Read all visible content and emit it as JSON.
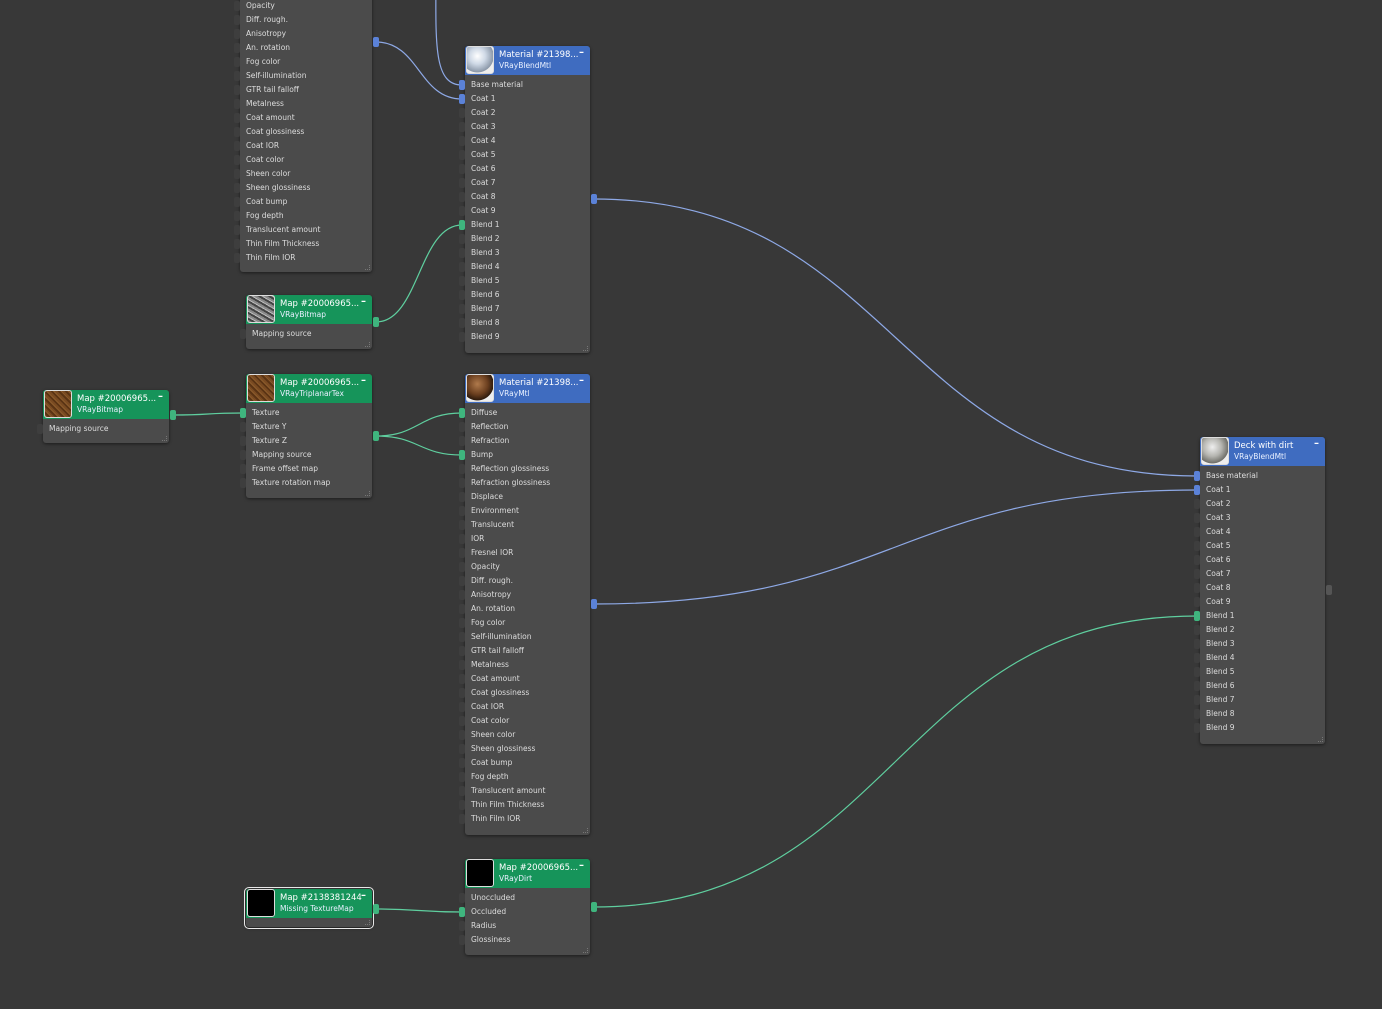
{
  "colors": {
    "material_header": "#3f6cc0",
    "map_header": "#16945a",
    "wire_material": "#8ea9e6",
    "wire_map": "#5fcf9f",
    "port_material": "#5b82d8",
    "port_map": "#3fb57e",
    "background": "#383838"
  },
  "nodes": [
    {
      "id": "vraymtl_top",
      "title": "",
      "type": "",
      "kind": "material",
      "thumb": "none",
      "rows": [
        "Opacity",
        "Diff. rough.",
        "Anisotropy",
        "An. rotation",
        "Fog color",
        "Self-illumination",
        "GTR tail falloff",
        "Metalness",
        "Coat amount",
        "Coat glossiness",
        "Coat IOR",
        "Coat color",
        "Sheen color",
        "Sheen glossiness",
        "Coat bump",
        "Fog depth",
        "Translucent amount",
        "Thin Film Thickness",
        "Thin Film IOR"
      ],
      "connected": []
    },
    {
      "id": "bitmap_top",
      "title": "Map #20006965...",
      "type": "VRayBitmap",
      "kind": "map",
      "thumb": "gray-texture",
      "rows": [
        "Mapping source"
      ],
      "connected": []
    },
    {
      "id": "blend_top",
      "title": "Material #21398...",
      "type": "VRayBlendMtl",
      "kind": "material",
      "thumb": "white-sphere",
      "rows": [
        "Base material",
        "Coat 1",
        "Coat 2",
        "Coat 3",
        "Coat 4",
        "Coat 5",
        "Coat 6",
        "Coat 7",
        "Coat 8",
        "Coat 9",
        "Blend 1",
        "Blend 2",
        "Blend 3",
        "Blend 4",
        "Blend 5",
        "Blend 6",
        "Blend 7",
        "Blend 8",
        "Blend 9"
      ],
      "connected": [
        "Base material",
        "Coat 1",
        "Blend 1"
      ]
    },
    {
      "id": "bitmap_left",
      "title": "Map #20006965...",
      "type": "VRayBitmap",
      "kind": "map",
      "thumb": "brown-texture",
      "rows": [
        "Mapping source"
      ],
      "connected": []
    },
    {
      "id": "triplanar",
      "title": "Map #20006965...",
      "type": "VRayTriplanarTex",
      "kind": "map",
      "thumb": "brown-texture",
      "rows": [
        "Texture",
        "Texture Y",
        "Texture Z",
        "Mapping source",
        "Frame offset map",
        "Texture rotation map"
      ],
      "connected": [
        "Texture"
      ]
    },
    {
      "id": "vraymtl_mid",
      "title": "Material #21398...",
      "type": "VRayMtl",
      "kind": "material",
      "thumb": "brown-sphere",
      "rows": [
        "Diffuse",
        "Reflection",
        "Refraction",
        "Bump",
        "Reflection glossiness",
        "Refraction glossiness",
        "Displace",
        "Environment",
        "Translucent",
        "IOR",
        "Fresnel IOR",
        "Opacity",
        "Diff. rough.",
        "Anisotropy",
        "An. rotation",
        "Fog color",
        "Self-illumination",
        "GTR tail falloff",
        "Metalness",
        "Coat amount",
        "Coat glossiness",
        "Coat IOR",
        "Coat color",
        "Sheen color",
        "Sheen glossiness",
        "Coat bump",
        "Fog depth",
        "Translucent amount",
        "Thin Film Thickness",
        "Thin Film IOR"
      ],
      "connected": [
        "Diffuse",
        "Bump"
      ]
    },
    {
      "id": "missing",
      "title": "Map #2138381244",
      "type": "Missing TextureMap",
      "kind": "map",
      "thumb": "black",
      "rows": [],
      "connected": [],
      "selected": true
    },
    {
      "id": "dirt",
      "title": "Map #20006965...",
      "type": "VRayDirt",
      "kind": "map",
      "thumb": "black",
      "rows": [
        "Unoccluded",
        "Occluded",
        "Radius",
        "Glossiness"
      ],
      "connected": [
        "Occluded"
      ]
    },
    {
      "id": "deck",
      "title": "Deck with dirt",
      "type": "VRayBlendMtl",
      "kind": "material",
      "thumb": "gray-sphere",
      "rows": [
        "Base material",
        "Coat 1",
        "Coat 2",
        "Coat 3",
        "Coat 4",
        "Coat 5",
        "Coat 6",
        "Coat 7",
        "Coat 8",
        "Coat 9",
        "Blend 1",
        "Blend 2",
        "Blend 3",
        "Blend 4",
        "Blend 5",
        "Blend 6",
        "Blend 7",
        "Blend 8",
        "Blend 9"
      ],
      "connected": [
        "Base material",
        "Coat 1",
        "Blend 1"
      ]
    }
  ],
  "links": [
    {
      "from": "offscreen",
      "to": "blend_top",
      "port": "Base material",
      "kind": "material"
    },
    {
      "from": "vraymtl_top",
      "to": "blend_top",
      "port": "Coat 1",
      "kind": "material"
    },
    {
      "from": "bitmap_top",
      "to": "blend_top",
      "port": "Blend 1",
      "kind": "map"
    },
    {
      "from": "bitmap_left",
      "to": "triplanar",
      "port": "Texture",
      "kind": "map"
    },
    {
      "from": "triplanar",
      "to": "vraymtl_mid",
      "port": "Diffuse",
      "kind": "map"
    },
    {
      "from": "triplanar",
      "to": "vraymtl_mid",
      "port": "Bump",
      "kind": "map"
    },
    {
      "from": "missing",
      "to": "dirt",
      "port": "Occluded",
      "kind": "map"
    },
    {
      "from": "blend_top",
      "to": "deck",
      "port": "Base material",
      "kind": "material"
    },
    {
      "from": "vraymtl_mid",
      "to": "deck",
      "port": "Coat 1",
      "kind": "material"
    },
    {
      "from": "dirt",
      "to": "deck",
      "port": "Blend 1",
      "kind": "map"
    }
  ]
}
